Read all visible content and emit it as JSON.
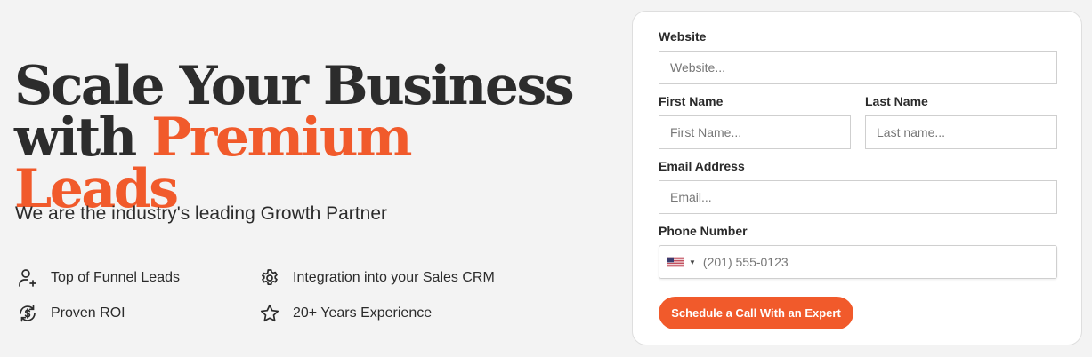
{
  "hero": {
    "headline_line1": "Scale Your Business",
    "headline_line2_plain": "with ",
    "headline_line2_accent": "Premium Leads",
    "subhead": "We are the industry's leading Growth Partner",
    "accent_color": "#f15a2b"
  },
  "features": [
    {
      "icon": "user-add-icon",
      "label": "Top of Funnel Leads"
    },
    {
      "icon": "gear-icon",
      "label": "Integration into your Sales CRM"
    },
    {
      "icon": "dollar-cycle-icon",
      "label": "Proven ROI"
    },
    {
      "icon": "star-icon",
      "label": "20+ Years Experience"
    }
  ],
  "form": {
    "website_label": "Website",
    "website_placeholder": "Website...",
    "first_name_label": "First Name",
    "first_name_placeholder": "First Name...",
    "last_name_label": "Last Name",
    "last_name_placeholder": "Last name...",
    "email_label": "Email Address",
    "email_placeholder": "Email...",
    "phone_label": "Phone Number",
    "phone_country": "US",
    "phone_placeholder": "(201) 555-0123",
    "submit_label": "Schedule a Call With an Expert"
  }
}
